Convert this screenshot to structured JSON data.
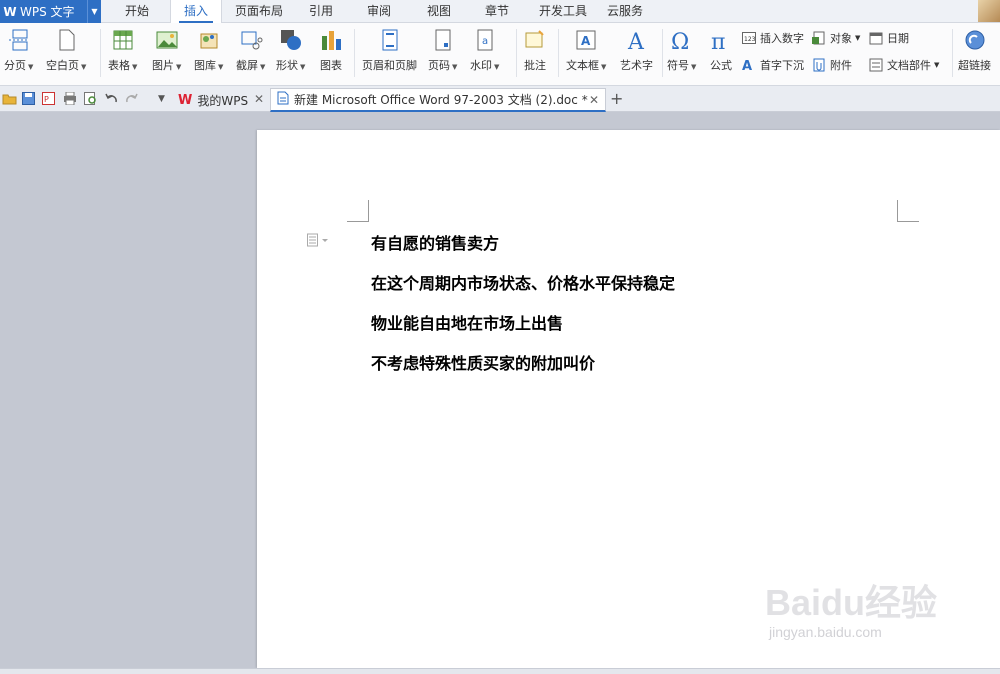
{
  "app": {
    "title": "WPS 文字"
  },
  "menu": {
    "tabs": [
      "开始",
      "插入",
      "页面布局",
      "引用",
      "审阅",
      "视图",
      "章节",
      "开发工具",
      "云服务"
    ],
    "active_index": 1
  },
  "ribbon": {
    "page_break": "分页",
    "blank_page": "空白页",
    "table": "表格",
    "picture": "图片",
    "gallery": "图库",
    "screenshot": "截屏",
    "shapes": "形状",
    "chart": "图表",
    "header_footer": "页眉和页脚",
    "page_number": "页码",
    "watermark": "水印",
    "comment": "批注",
    "textbox": "文本框",
    "wordart": "艺术字",
    "symbol": "符号",
    "formula": "公式",
    "insert_number": "插入数字",
    "object": "对象",
    "date": "日期",
    "drop_cap": "首字下沉",
    "attachment": "附件",
    "doc_parts": "文档部件",
    "hyperlink": "超链接"
  },
  "doc_tabs": {
    "home_tab": "我的WPS",
    "active_tab": "新建 Microsoft Office Word 97-2003 文档 (2).doc *"
  },
  "document": {
    "lines": [
      "有自愿的销售卖方",
      "在这个周期内市场状态、价格水平保持稳定",
      "物业能自由地在市场上出售",
      "不考虑特殊性质买家的附加叫价"
    ]
  },
  "watermark": {
    "brand": "Baidu经验",
    "url": "jingyan.baidu.com"
  },
  "colors": {
    "accent": "#2e6fc4"
  }
}
